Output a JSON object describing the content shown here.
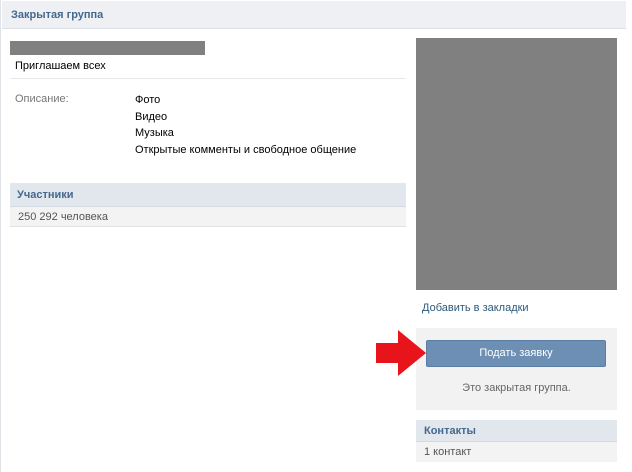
{
  "header": {
    "title": "Закрытая группа"
  },
  "group": {
    "status": "Приглашаем всех",
    "description_label": "Описание:",
    "description_items": [
      "Фото",
      "Видео",
      "Музыка",
      "Открытые комменты и свободное общение"
    ]
  },
  "members": {
    "title": "Участники",
    "count": "250 292 человека"
  },
  "sidebar": {
    "bookmark_link": "Добавить в закладки",
    "join_button": "Подать заявку",
    "join_note": "Это закрытая группа."
  },
  "contacts": {
    "title": "Контакты",
    "count": "1 контакт"
  },
  "colors": {
    "link": "#2b587a",
    "header_text": "#45688e",
    "button": "#6d8fb3",
    "arrow": "#e8141b",
    "redacted": "#808080"
  },
  "icons": {
    "pointer": "red-arrow-icon"
  }
}
